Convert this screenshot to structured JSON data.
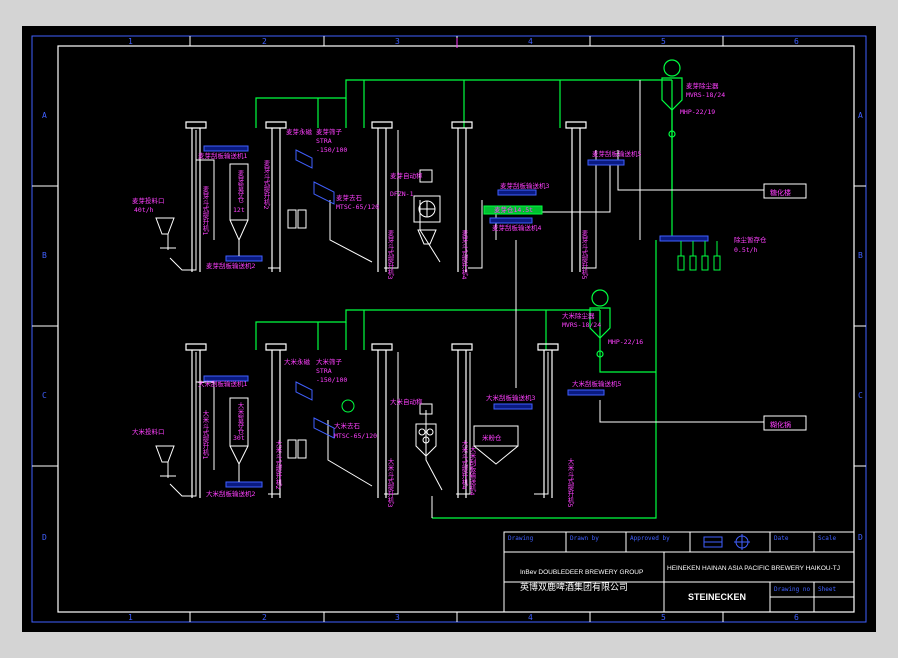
{
  "colors": {
    "frame": "#ffffff",
    "pipe_green": "#00ff40",
    "label_magenta": "#ff40ff",
    "equipment_blue": "#4060ff",
    "title_red": "#ff3030",
    "title_blue": "#4060ff",
    "background": "#000000"
  },
  "grid_columns": [
    "1",
    "2",
    "3",
    "4",
    "5",
    "6"
  ],
  "grid_rows": [
    "A",
    "B",
    "C",
    "D"
  ],
  "top_line": {
    "labels": {
      "mill_b1": "麦芽斗式提升机1",
      "mill_b2": "麦芽斗式提升机2",
      "mill_b3": "麦芽斗式提升机3",
      "mill_b4": "麦芽斗式提升机4",
      "mill_b5": "麦芽斗式提升机5",
      "intake": "麦芽投料口",
      "intake_rate": "40t/h",
      "conv1": "麦芽刮板输送机1",
      "conv2": "麦芽刮板输送机2",
      "conv3": "麦芽刮板输送机3",
      "conv4": "麦芽刮板输送机4",
      "conv5": "麦芽刮板输送机5",
      "silo": "麦芽暂存仓",
      "silo_cap": "12t",
      "magnet": "麦芽永磁",
      "sieve": "麦芽筛子",
      "sieve_model": "STRA",
      "sieve_spec": "-150/100",
      "stoner": "麦芽去石",
      "stoner_model": "MTSC-65/120",
      "scale": "麦芽自动称",
      "scale_model": "DFZN-1",
      "bin": "麦芽仓14.5t",
      "filter": "麦芽除尘器",
      "filter_model": "MVRS-18/24",
      "fan": "MHP-22/19",
      "dust_bin": "除尘暂存仓",
      "dust_bin_cap": "0.5t/h",
      "dest": "糖化楼"
    }
  },
  "bottom_line": {
    "labels": {
      "rice_b1": "大米斗式提升机1",
      "rice_b2": "大米斗式提升机2",
      "rice_b3": "大米斗式提升机3",
      "rice_b4": "大米斗式提升机4",
      "rice_b5": "大米斗式提升机5",
      "intake": "大米投料口",
      "conv1": "大米刮板输送机1",
      "conv2": "大米刮板输送机2",
      "conv3": "大米刮板输送机3",
      "conv4": "大米刮板输送机4",
      "conv5": "大米刮板输送机5",
      "silo": "大米暂存仓",
      "silo_cap": "30t",
      "magnet": "大米永磁",
      "sieve": "大米筛子",
      "sieve_model": "STRA",
      "sieve_spec": "-150/100",
      "stoner": "大米去石",
      "stoner_model": "MTSC-65/120",
      "scale": "大米自动称",
      "bin": "米粉仓",
      "filter": "大米除尘器",
      "filter_model": "MVRS-18/24",
      "fan": "MHP-22/16",
      "dest": "糊化锅"
    }
  },
  "title_block": {
    "company_en": "InBev DOUBLEDEER BREWERY GROUP",
    "company_cn": "英博双鹿啤酒集团有限公司",
    "project": "HEINEKEN HAINAN ASIA PACIFIC BREWERY  HAIKOU-TJ",
    "vendor": "STEINECKEN",
    "cells": {
      "c1": "Drawing",
      "c2": "Drawn by",
      "c3": "Approved by",
      "c4": "Date",
      "c5": "Scale",
      "c6": "Drawing no",
      "c7": "Sheet"
    }
  }
}
